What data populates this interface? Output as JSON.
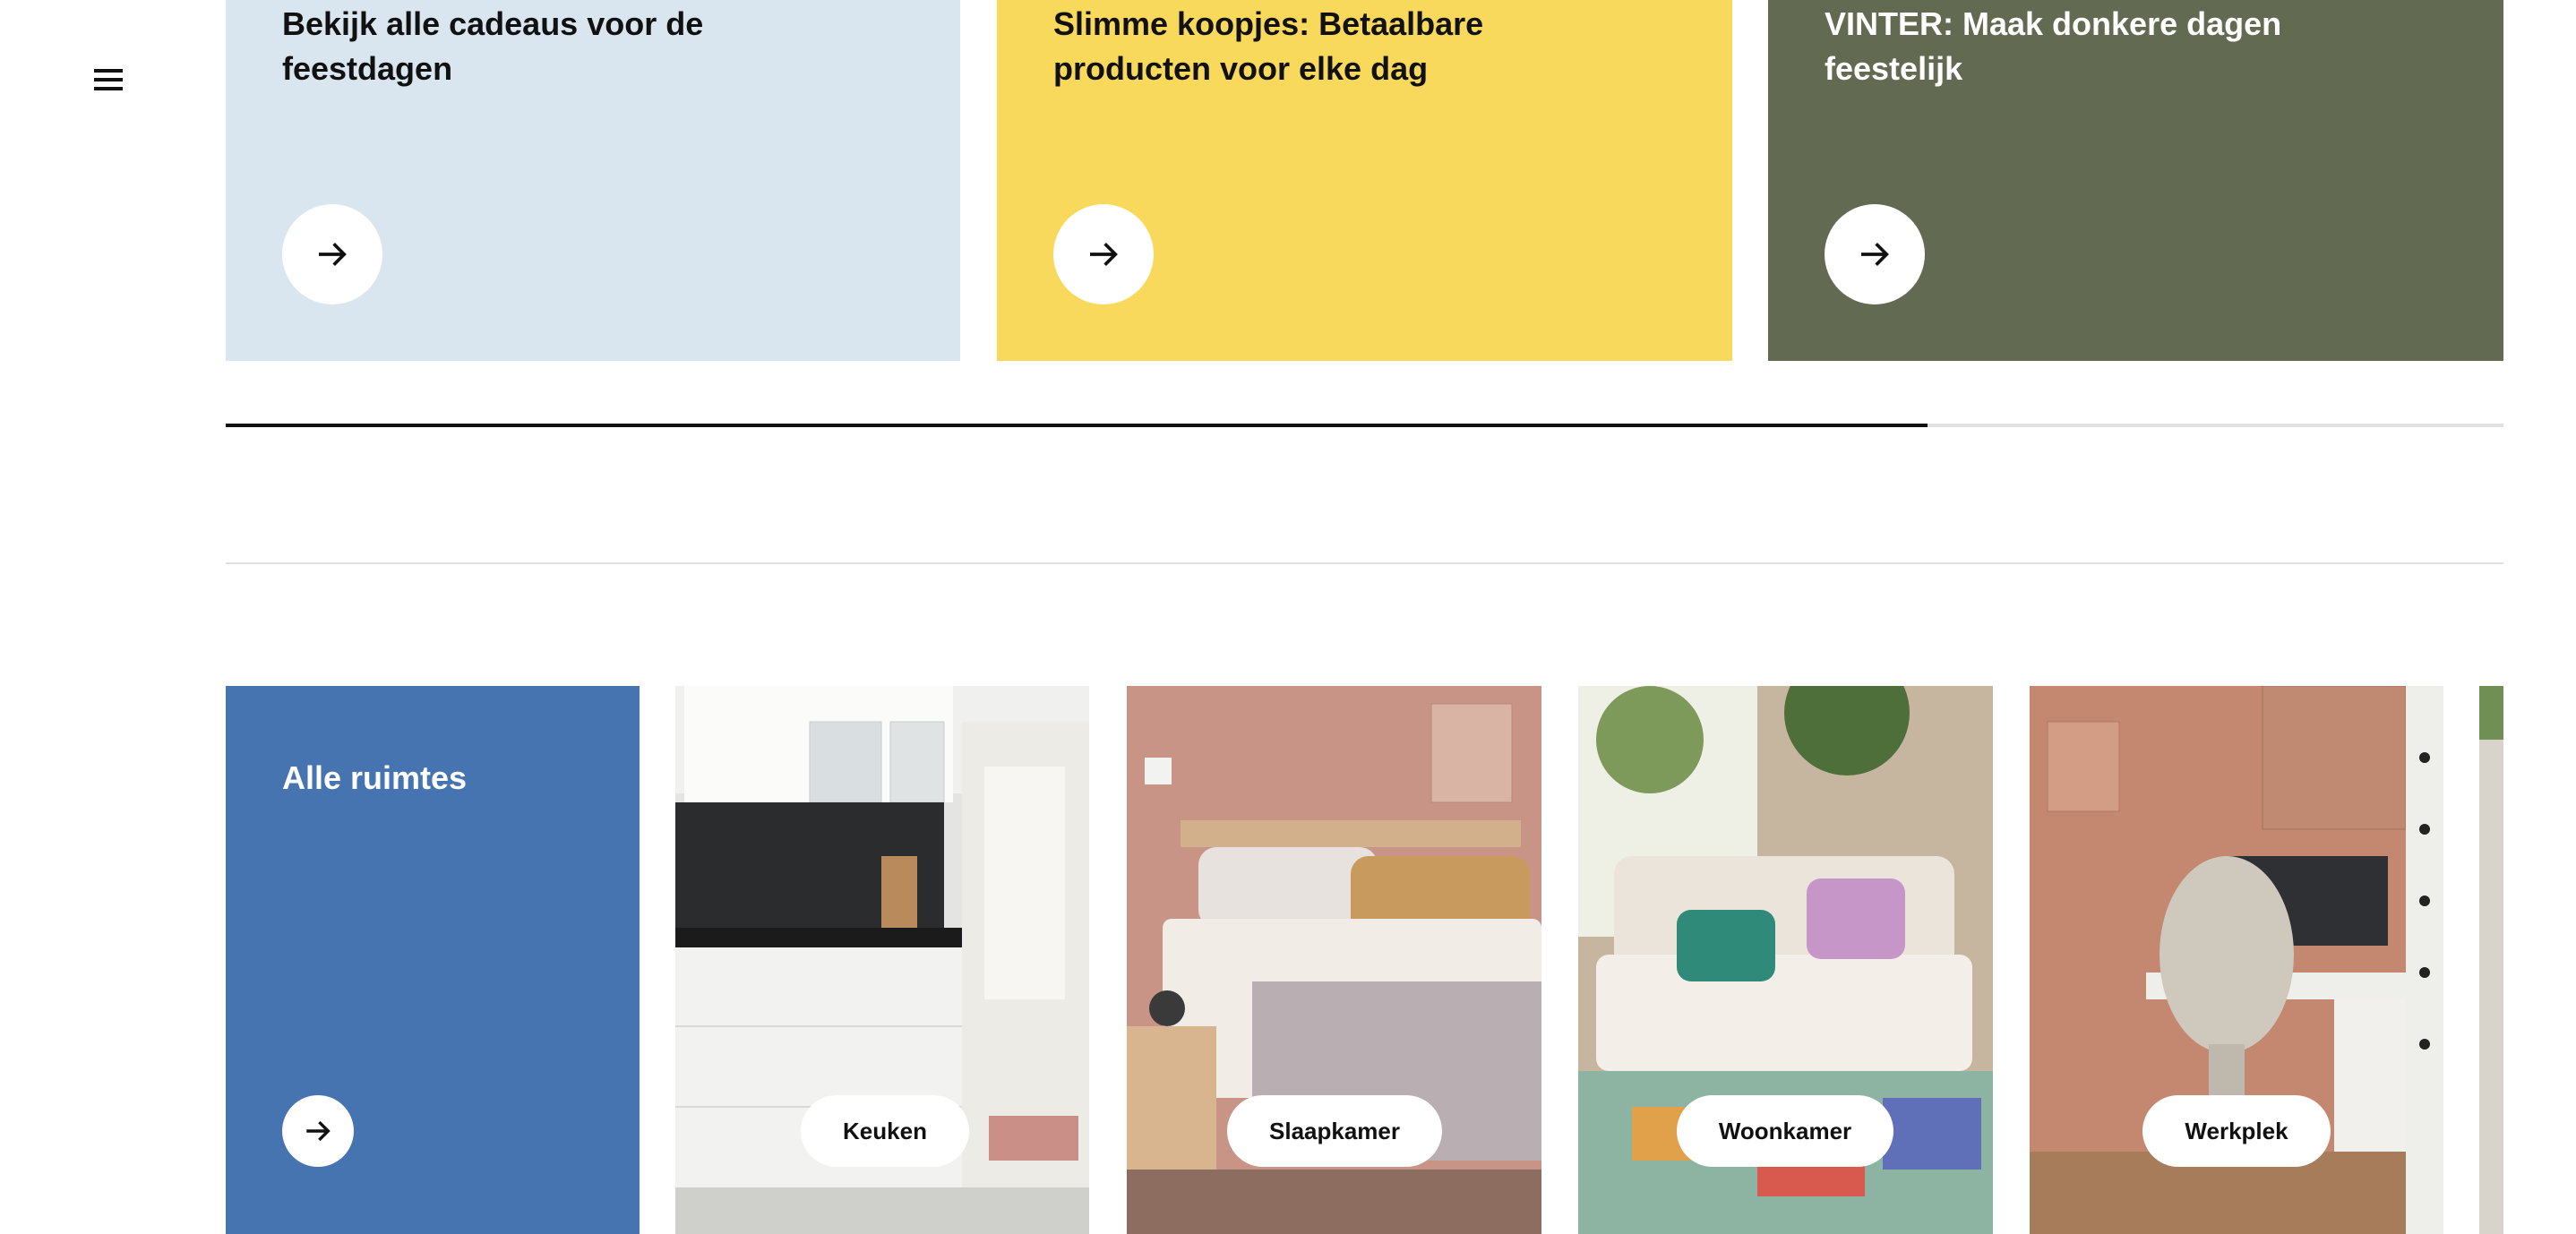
{
  "menu": {
    "icon": "menu-icon"
  },
  "promos": [
    {
      "title": "Bekijk alle cadeaus voor de feestdagen",
      "color": "#d9e6ef",
      "text_color": "#111111",
      "icon": "arrow-right-icon"
    },
    {
      "title": "Slimme koopjes: Betaalbare producten voor elke dag",
      "color": "#f9d95b",
      "text_color": "#111111",
      "icon": "arrow-right-icon"
    },
    {
      "title": "VINTER: Maak donkere dagen feestelijk",
      "color": "#626a51",
      "text_color": "#ffffff",
      "icon": "arrow-right-icon"
    }
  ],
  "carousel": {
    "scroll_progress": 0.747
  },
  "rooms": {
    "all_label": "Alle ruimtes",
    "all_color": "#4574b0",
    "items": [
      {
        "label": "Keuken"
      },
      {
        "label": "Slaapkamer"
      },
      {
        "label": "Woonkamer"
      },
      {
        "label": "Werkplek"
      }
    ]
  }
}
